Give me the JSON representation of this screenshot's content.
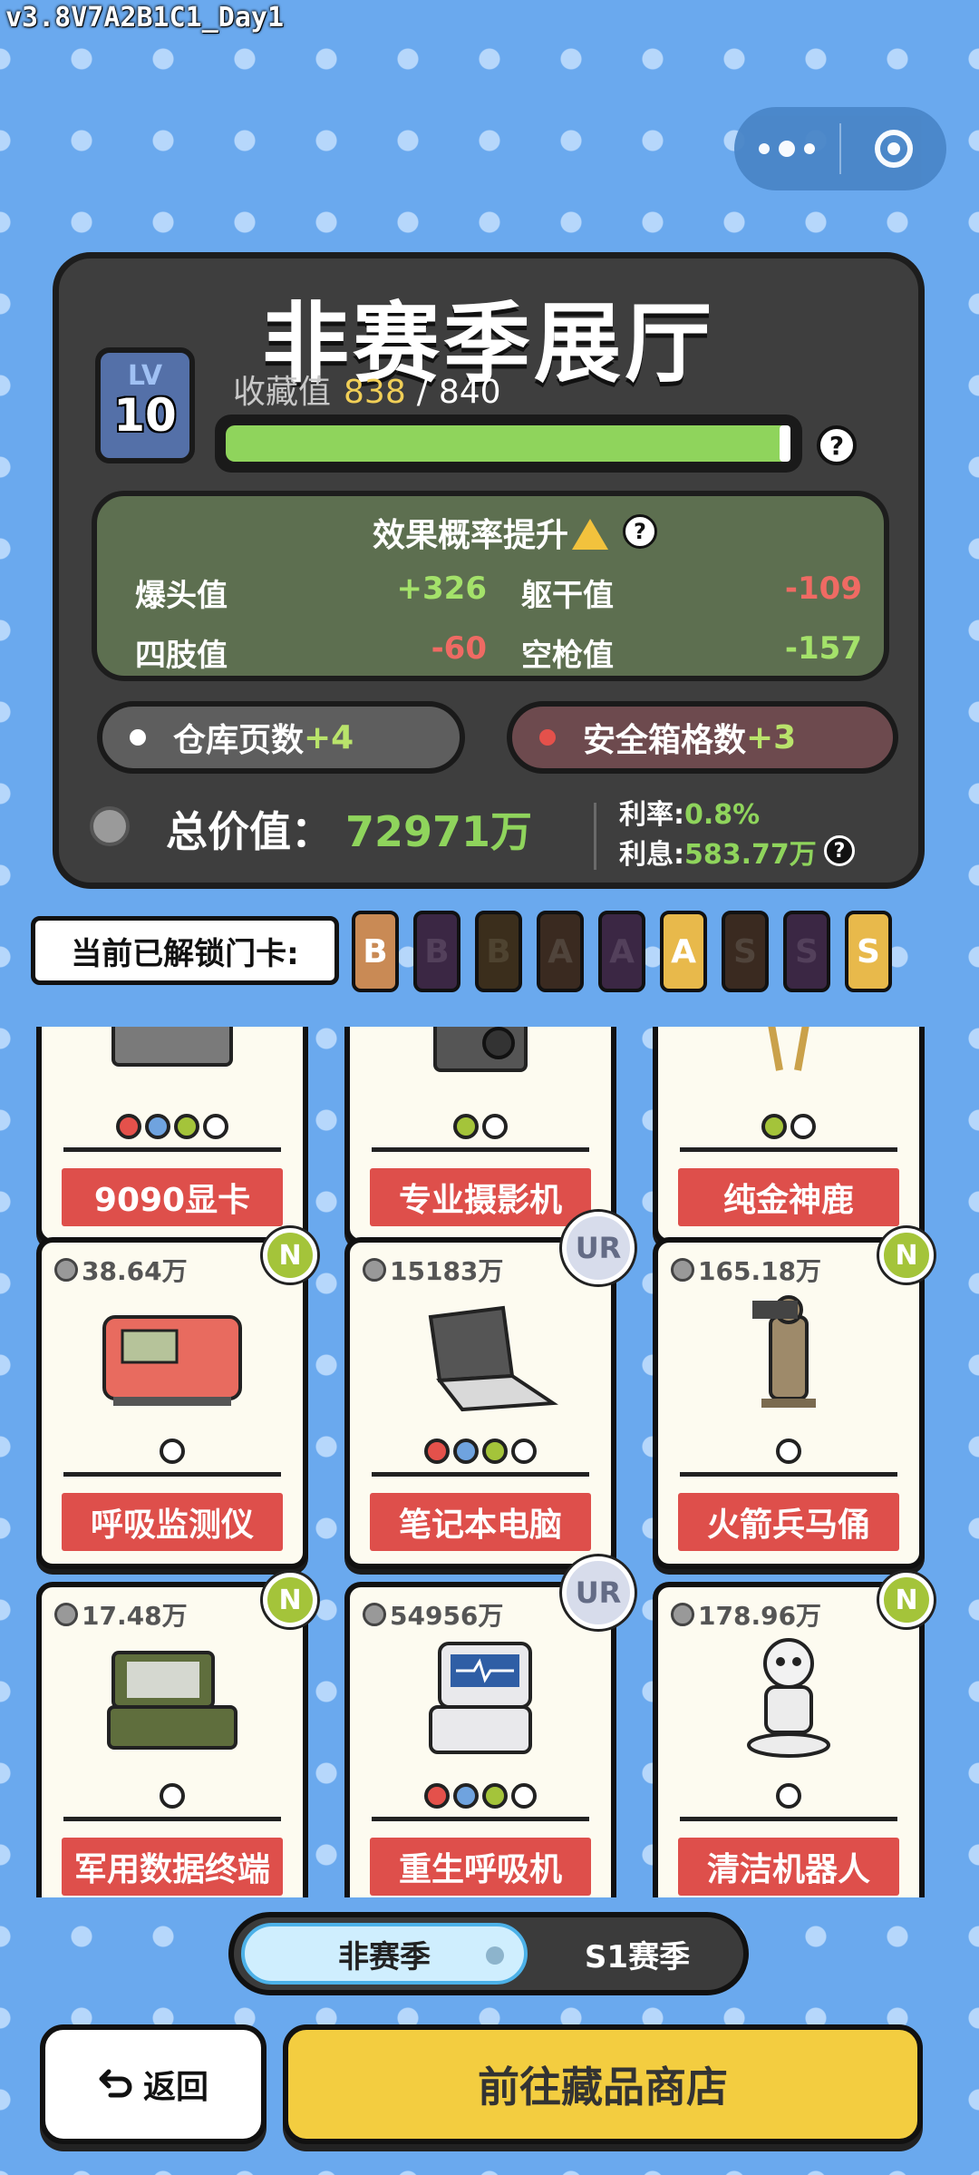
{
  "version": "v3.8V7A2B1C1_Day1",
  "hall": {
    "title": "非赛季展厅",
    "level_label": "LV",
    "level": "10",
    "collect_label": "收藏值",
    "collect_current": "838",
    "collect_sep": "/",
    "collect_max": "840",
    "progress": 0.9976
  },
  "effect": {
    "title": "效果概率提升",
    "stats": [
      {
        "label": "爆头值",
        "value": "+326",
        "color": "#a4e26a"
      },
      {
        "label": "躯干值",
        "value": "-109",
        "color": "#ef6a63"
      },
      {
        "label": "四肢值",
        "value": "-60",
        "color": "#ef6a63"
      },
      {
        "label": "空枪值",
        "value": "-157",
        "color": "#a4e26a"
      }
    ]
  },
  "warehouse": {
    "label": "仓库页数",
    "plus": "+4"
  },
  "safebox": {
    "label": "安全箱格数",
    "plus": "+3"
  },
  "total": {
    "label": "总价值：",
    "value": "72971万",
    "rate_label": "利率:",
    "rate_value": "0.8%",
    "interest_label": "利息:",
    "interest_value": "583.77万"
  },
  "unlock": {
    "label": "当前已解锁门卡:",
    "cards": [
      {
        "letter": "B",
        "bg": "#c98a55",
        "fg": "#ffffff"
      },
      {
        "letter": "B",
        "bg": "#3b2744",
        "fg": "#53405b"
      },
      {
        "letter": "B",
        "bg": "#3b2e1c",
        "fg": "#4e4330"
      },
      {
        "letter": "A",
        "bg": "#3a2a20",
        "fg": "#50443b"
      },
      {
        "letter": "A",
        "bg": "#3b2744",
        "fg": "#53405b"
      },
      {
        "letter": "A",
        "bg": "#e8b94b",
        "fg": "#ffffff"
      },
      {
        "letter": "S",
        "bg": "#3a2a20",
        "fg": "#50443b"
      },
      {
        "letter": "S",
        "bg": "#3b2744",
        "fg": "#53405b"
      },
      {
        "letter": "S",
        "bg": "#e8b94b",
        "fg": "#ffffff"
      }
    ]
  },
  "items_top": [
    {
      "name": "9090显卡"
    },
    {
      "name": "专业摄影机"
    },
    {
      "name": "纯金神鹿"
    }
  ],
  "items": [
    {
      "price": "38.64万",
      "name": "呼吸监测仪",
      "badge": "N"
    },
    {
      "price": "15183万",
      "name": "笔记本电脑",
      "badge": "UR"
    },
    {
      "price": "165.18万",
      "name": "火箭兵马俑",
      "badge": "N"
    },
    {
      "price": "17.48万",
      "name": "军用数据终端",
      "badge": "N"
    },
    {
      "price": "54956万",
      "name": "重生呼吸机",
      "badge": "UR"
    },
    {
      "price": "178.96万",
      "name": "清洁机器人",
      "badge": "N"
    }
  ],
  "season": {
    "active": "非赛季",
    "inactive": "S1赛季"
  },
  "buttons": {
    "back": "返回",
    "shop": "前往藏品商店"
  }
}
